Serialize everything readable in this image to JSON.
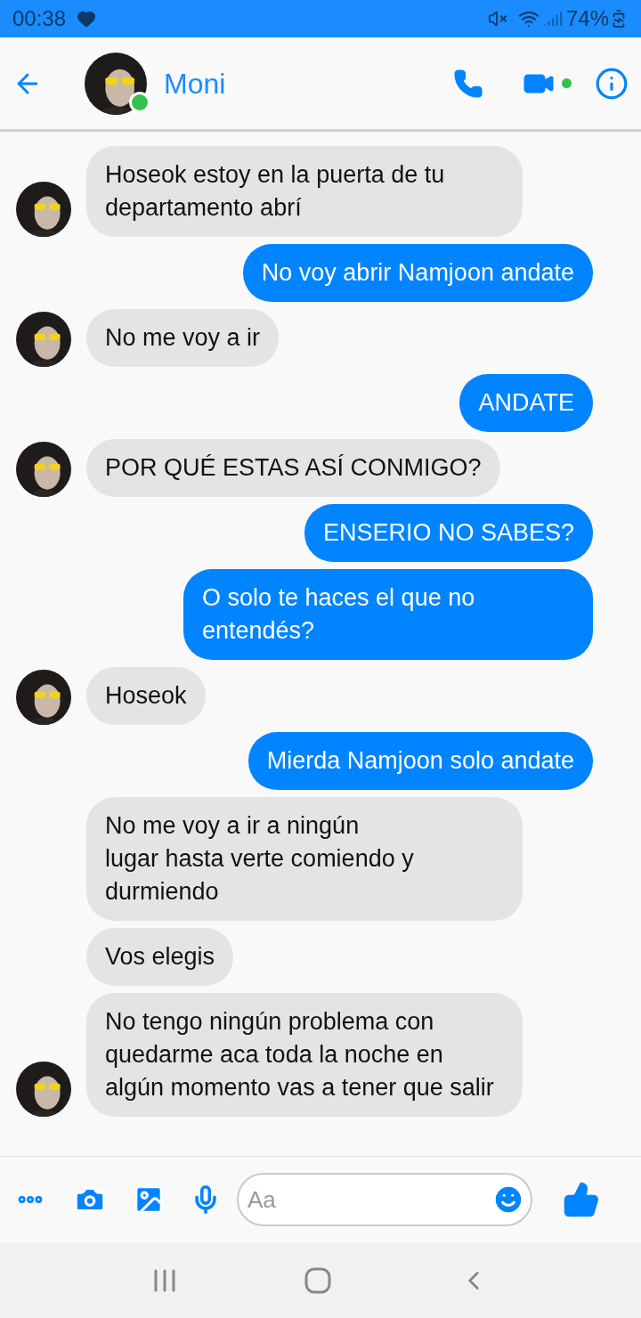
{
  "status_bar": {
    "time": "00:38",
    "battery": "74%"
  },
  "header": {
    "name": "Moni",
    "online": true,
    "video_active": true
  },
  "messages": [
    {
      "kind": "incoming",
      "text": "Hoseok estoy en la puerta de tu departamento abrí",
      "avatar": true
    },
    {
      "kind": "outgoing",
      "text": "No voy abrir Namjoon andate"
    },
    {
      "kind": "incoming",
      "text": "No me voy a ir",
      "avatar": true
    },
    {
      "kind": "outgoing",
      "text": "ANDATE"
    },
    {
      "kind": "incoming",
      "text": "POR QUÉ ESTAS ASÍ CONMIGO?",
      "avatar": true
    },
    {
      "kind": "outgoing",
      "text": "ENSERIO NO SABES?"
    },
    {
      "kind": "outgoing",
      "text": "O solo te haces el que no entendés?"
    },
    {
      "kind": "incoming",
      "text": "Hoseok",
      "avatar": true
    },
    {
      "kind": "outgoing",
      "text": "Mierda Namjoon solo andate"
    },
    {
      "kind": "incoming",
      "text": "No me voy a ir a ningún\nlugar hasta verte comiendo y durmiendo",
      "avatar": false
    },
    {
      "kind": "incoming",
      "text": "Vos elegis",
      "avatar": false
    },
    {
      "kind": "incoming",
      "text": "No tengo ningún problema con quedarme aca toda la noche en algún momento vas a tener que salir",
      "avatar": true
    }
  ],
  "composer": {
    "placeholder": "Aa"
  }
}
